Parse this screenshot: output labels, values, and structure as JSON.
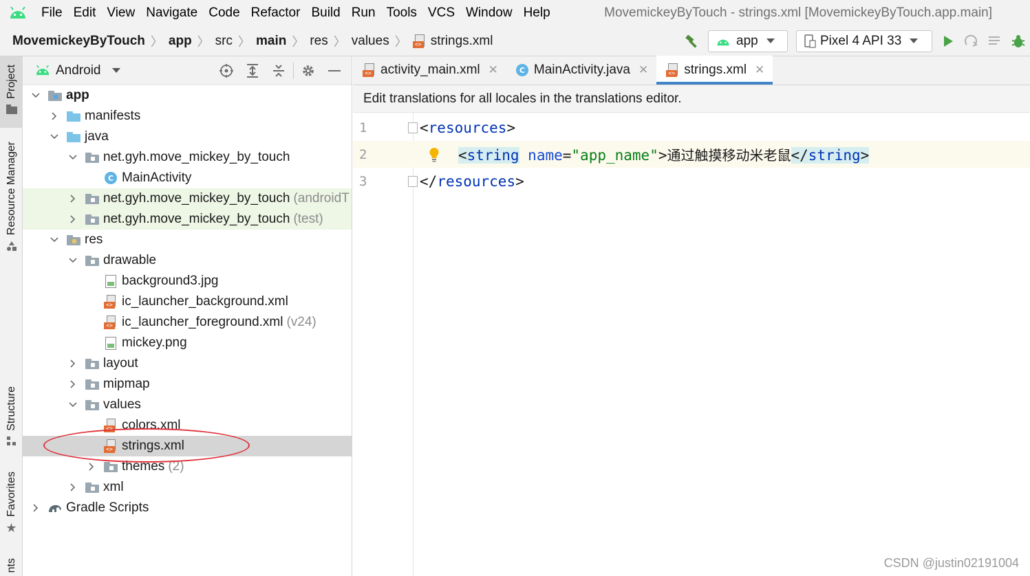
{
  "menubar": {
    "items": [
      "File",
      "Edit",
      "View",
      "Navigate",
      "Code",
      "Refactor",
      "Build",
      "Run",
      "Tools",
      "VCS",
      "Window",
      "Help"
    ],
    "window_title": "MovemickeyByTouch - strings.xml [MovemickeyByTouch.app.main]"
  },
  "navbar": {
    "crumbs": [
      "MovemickeyByTouch",
      "app",
      "src",
      "main",
      "res",
      "values"
    ],
    "file": "strings.xml",
    "run_config": "app",
    "device": "Pixel 4 API 33"
  },
  "stripe": {
    "project": "Project",
    "resource_manager": "Resource Manager",
    "structure": "Structure",
    "favorites": "Favorites",
    "variants": "nts"
  },
  "project_panel": {
    "view_mode": "Android",
    "tree": [
      {
        "label": "app",
        "bold": true
      },
      {
        "label": "manifests"
      },
      {
        "label": "java"
      },
      {
        "label": "net.gyh.move_mickey_by_touch"
      },
      {
        "label": "MainActivity"
      },
      {
        "label": "net.gyh.move_mickey_by_touch",
        "hint": "(androidT"
      },
      {
        "label": "net.gyh.move_mickey_by_touch",
        "hint": "(test)"
      },
      {
        "label": "res"
      },
      {
        "label": "drawable"
      },
      {
        "label": "background3.jpg"
      },
      {
        "label": "ic_launcher_background.xml"
      },
      {
        "label": "ic_launcher_foreground.xml",
        "hint": "(v24)"
      },
      {
        "label": "mickey.png"
      },
      {
        "label": "layout"
      },
      {
        "label": "mipmap"
      },
      {
        "label": "values"
      },
      {
        "label": "colors.xml"
      },
      {
        "label": "strings.xml"
      },
      {
        "label": "themes",
        "hint": "(2)"
      },
      {
        "label": "xml"
      },
      {
        "label": "Gradle Scripts"
      }
    ]
  },
  "editor": {
    "tabs": [
      "activity_main.xml",
      "MainActivity.java",
      "strings.xml"
    ],
    "active_tab": "strings.xml",
    "banner": "Edit translations for all locales in the translations editor.",
    "lines": [
      {
        "number": "1"
      },
      {
        "number": "2",
        "attr_name": "name",
        "attr_value": "\"app_name\"",
        "text": "通过触摸移动米老鼠"
      },
      {
        "number": "3"
      }
    ],
    "tag_resources": "resources",
    "tag_string": "string"
  },
  "watermark": "CSDN @justin02191004",
  "colors": {
    "android_green": "#3ddc84",
    "selection": "#d5d5d5",
    "accent_blue": "#4083c9",
    "annotation_red": "#e0323c",
    "xml_badge": "#e26d34"
  }
}
